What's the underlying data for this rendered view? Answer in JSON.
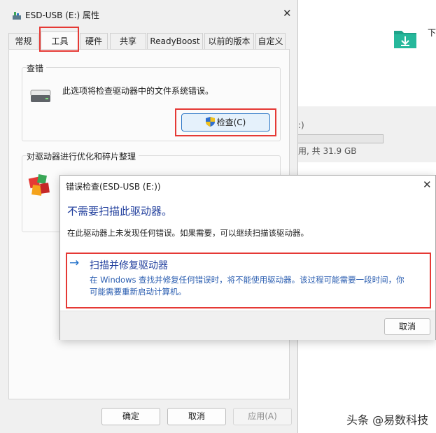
{
  "background": {
    "drive_letter_fragment": ":)",
    "drive_size_fragment": "用, 共 31.9 GB",
    "download_label_fragment": "下"
  },
  "properties": {
    "title": "ESD-USB (E:) 属性",
    "tabs": [
      "常规",
      "工具",
      "硬件",
      "共享",
      "ReadyBoost",
      "以前的版本",
      "自定义"
    ],
    "active_tab": "工具",
    "check_group": {
      "label": "查错",
      "description": "此选项将检查驱动器中的文件系统错误。",
      "button": "检查(C)"
    },
    "optimize_group": {
      "label": "对驱动器进行优化和碎片整理"
    },
    "buttons": {
      "ok": "确定",
      "cancel": "取消",
      "apply": "应用(A)"
    }
  },
  "error_check": {
    "title": "错误检查(ESD-USB (E:))",
    "heading": "不需要扫描此驱动器。",
    "message": "在此驱动器上未发现任何错误。如果需要，可以继续扫描该驱动器。",
    "command_title": "扫描并修复驱动器",
    "command_desc_line1": "在 Windows 查找并修复任何错误时，将不能使用驱动器。该过程可能需要一段时间，你",
    "command_desc_line2": "可能需要重新启动计算机。",
    "cancel": "取消"
  },
  "watermark": "头条 @易数科技",
  "colors": {
    "highlight": "#e53935",
    "link": "#1f3d9c",
    "accent": "#2e78c7",
    "folder": "#1fa38a"
  },
  "icons": [
    "drive-icon",
    "close-icon",
    "hdd-icon",
    "shield-icon",
    "defrag-icon",
    "arrow-right-icon",
    "download-folder-icon"
  ]
}
